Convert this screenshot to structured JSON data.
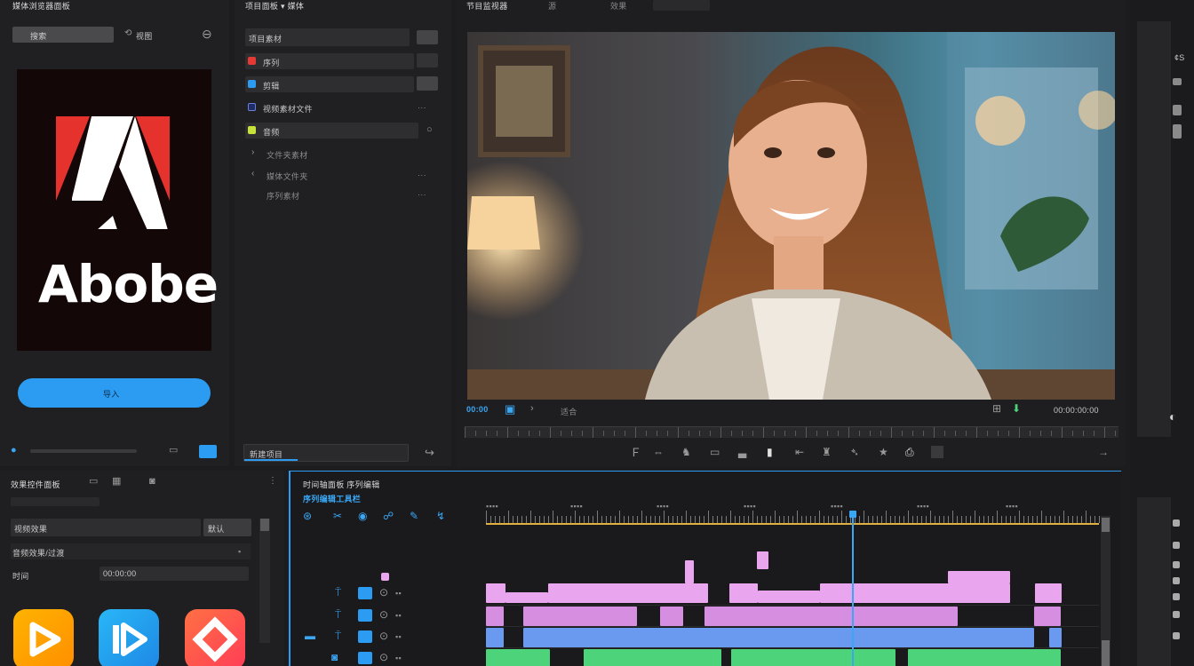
{
  "colors": {
    "accent": "#2b9cf2",
    "clip_pink": "#e9a6ee",
    "clip_blue": "#6a9af0",
    "clip_green": "#4dd47a",
    "playhead": "#3aa7f5",
    "ruler_line": "#e0b040"
  },
  "left_panel": {
    "title": "媒体浏览器面板",
    "search_placeholder": "搜索",
    "view_label": "视图",
    "logo_text": "Abobe",
    "import_button": "导入",
    "icons": [
      "globe-icon",
      "square-icon",
      "grid-icon"
    ]
  },
  "project_panel": {
    "title": "项目面板 ▾ 媒体",
    "items": [
      {
        "label": "项目素材",
        "icon_color": "#555555"
      },
      {
        "label": "序列",
        "icon_color": "#e53935"
      },
      {
        "label": "剪辑",
        "icon_color": "#2b9cf2"
      },
      {
        "label": "视频素材文件",
        "icon_color": "#3949ab"
      },
      {
        "label": "音频",
        "icon_color": "#c6e23a"
      },
      {
        "label": "文件夹素材",
        "icon_color": ""
      },
      {
        "label": "媒体文件夹",
        "icon_color": ""
      },
      {
        "label": "序列素材",
        "icon_color": ""
      }
    ],
    "footer_input": "新建项目"
  },
  "monitor": {
    "tabs": [
      "节目监视器",
      "源",
      "效果"
    ],
    "timecode_left": "00:00",
    "timecode_right": "00:00:00:00",
    "fit_label": "适合"
  },
  "effects_panel": {
    "title": "效果控件面板",
    "row1_label": "视频效果",
    "row1_value": "默认",
    "row2_label": "音频效果/过渡",
    "row3_label": "时间",
    "row3_value": "00:00:00"
  },
  "timeline": {
    "title": "时间轴面板 序列编辑",
    "subtitle": "序列编辑工具栏"
  },
  "app_icons": [
    {
      "name": "app-play-orange",
      "from": "#ff9800",
      "to": "#ffb300"
    },
    {
      "name": "app-play-blue",
      "from": "#1e88e5",
      "to": "#29b6f6"
    },
    {
      "name": "app-diamond-red",
      "from": "#ff5252",
      "to": "#ff7043"
    }
  ]
}
